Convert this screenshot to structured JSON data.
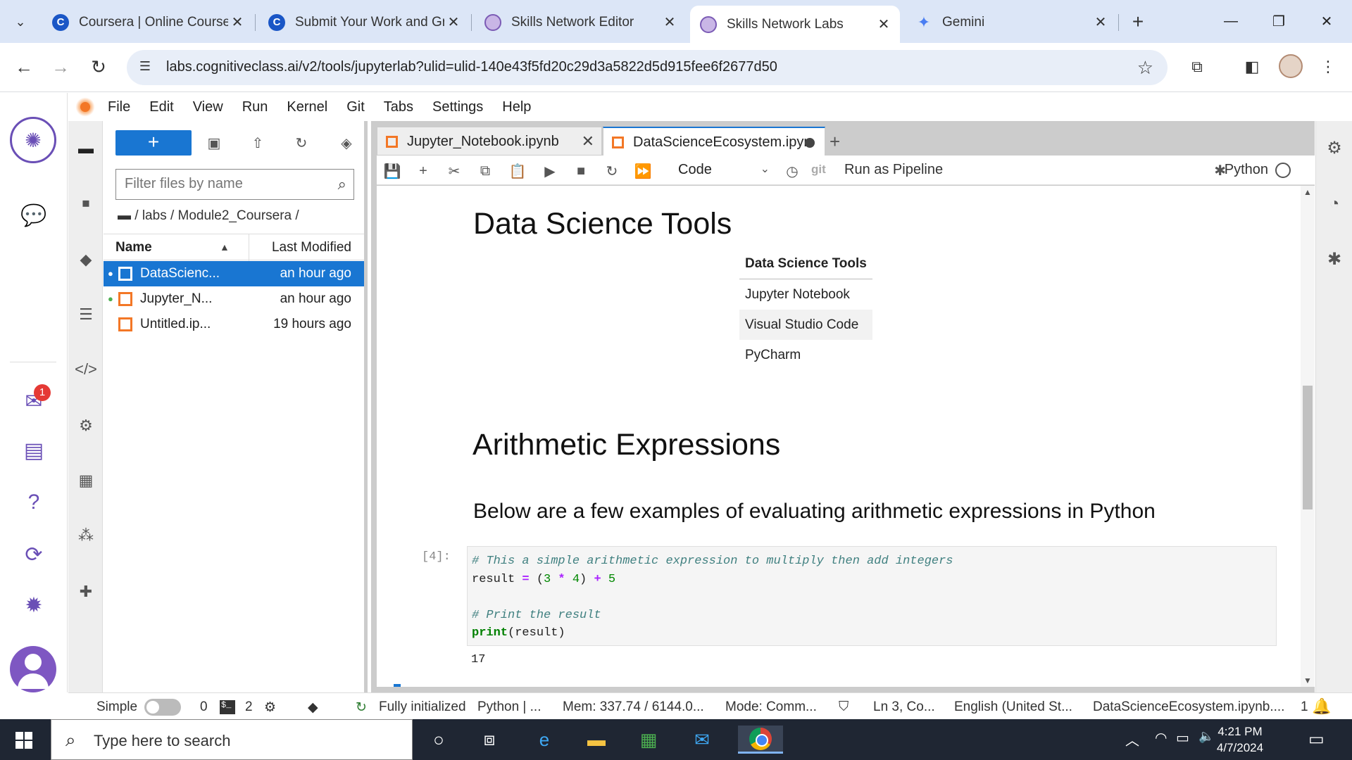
{
  "browser": {
    "tabs": [
      {
        "title": "Coursera | Online Courses",
        "favicon": "coursera-icon"
      },
      {
        "title": "Submit Your Work and Grade",
        "favicon": "coursera-icon"
      },
      {
        "title": "Skills Network Editor",
        "favicon": "skills-network-icon"
      },
      {
        "title": "Skills Network Labs",
        "favicon": "skills-network-icon",
        "active": true
      },
      {
        "title": "Gemini",
        "favicon": "gemini-icon"
      }
    ],
    "url": "labs.cognitiveclass.ai/v2/tools/jupyterlab?ulid=ulid-140e43f5fd20c29d3a5822d5d915fee6f2677d50",
    "favicon_letters": {
      "coursera": "C"
    }
  },
  "sn_rail": {
    "notification_count": "1"
  },
  "menu": [
    "File",
    "Edit",
    "View",
    "Run",
    "Kernel",
    "Git",
    "Tabs",
    "Settings",
    "Help"
  ],
  "filebrowser": {
    "new_label": "+",
    "filter_placeholder": "Filter files by name",
    "breadcrumb": "/ labs / Module2_Coursera /",
    "col_name": "Name",
    "col_modified": "Last Modified",
    "files": [
      {
        "name": "DataScienc...",
        "modified": "an hour ago",
        "selected": true,
        "running": true
      },
      {
        "name": "Jupyter_N...",
        "modified": "an hour ago",
        "selected": false,
        "running": true
      },
      {
        "name": "Untitled.ip...",
        "modified": "19 hours ago",
        "selected": false,
        "running": false
      }
    ]
  },
  "doc_tabs": [
    {
      "label": "Jupyter_Notebook.ipynb"
    },
    {
      "label": "DataScienceEcosystem.ipyn"
    }
  ],
  "toolbar": {
    "cell_type": "Code",
    "git": "git",
    "pipeline": "Run as Pipeline",
    "kernel": "Python"
  },
  "notebook": {
    "heading_tools": "Data Science Tools",
    "table": {
      "header": "Data Science Tools",
      "rows": [
        "Jupyter Notebook",
        "Visual Studio Code",
        "PyCharm"
      ]
    },
    "heading_arith": "Arithmetic Expressions",
    "heading_below": "Below are a few examples of evaluating arithmetic expressions in Python",
    "prompt": "[4]:",
    "code": {
      "line1": "# This a simple arithmetic expression to multiply then add integers",
      "line2_var": "result ",
      "line2_eq": "=",
      "line2_open": " (",
      "line2_a": "3",
      "line2_mul": " * ",
      "line2_b": "4",
      "line2_close": ") ",
      "line2_plus": "+",
      "line2_c": " 5",
      "line4": "# Print the result",
      "line5_fn": "print",
      "line5_args": "(result)"
    },
    "output": "17"
  },
  "status": {
    "mode_simple": "Simple",
    "count_a": "0",
    "count_b": "2",
    "kernel_state": "Fully initialized",
    "kernel_name": "Python | ...",
    "memory": "Mem: 337.74 / 6144.0...",
    "mode": "Mode: Comm...",
    "position": "Ln 3, Co...",
    "language": "English (United St...",
    "filename": "DataScienceEcosystem.ipynb....",
    "notif_count": "1"
  },
  "taskbar": {
    "search_placeholder": "Type here to search",
    "time": "4:21 PM",
    "date": "4/7/2024"
  }
}
